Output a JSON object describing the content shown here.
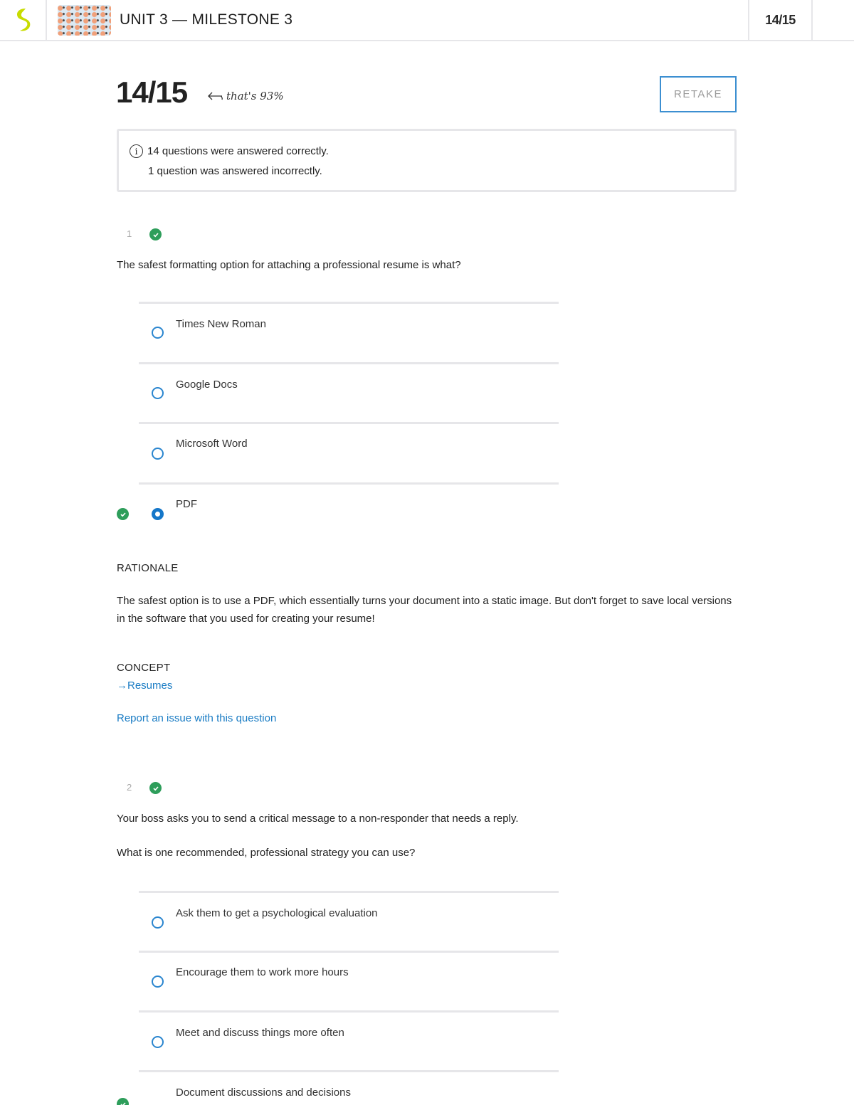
{
  "header": {
    "logo_icon": "sophia-logo-icon",
    "course_thumbnail": "course-thumbnail",
    "title": "UNIT 3 — MILESTONE 3",
    "score": "14/15"
  },
  "results": {
    "score": "14/15",
    "percent_note": "that's 93%",
    "percent_value": 93,
    "retake_label": "RETAKE",
    "summary_correct": "14 questions were answered correctly.",
    "summary_incorrect": "1 question was answered incorrectly."
  },
  "questions": [
    {
      "number": "1",
      "status": "correct",
      "text": "The safest formatting option for attaching a professional resume is what?",
      "options": [
        {
          "label": "Times New Roman",
          "selected": false,
          "correct": false
        },
        {
          "label": "Google Docs",
          "selected": false,
          "correct": false
        },
        {
          "label": "Microsoft Word",
          "selected": false,
          "correct": false
        },
        {
          "label": "PDF",
          "selected": true,
          "correct": true
        }
      ],
      "rationale_heading": "RATIONALE",
      "rationale": "The safest option is to use a PDF, which essentially turns your document into a static image. But don't forget to save local versions in the software that you used for creating your resume!",
      "concept_heading": "CONCEPT",
      "concept_link": "Resumes",
      "report_link": "Report an issue with this question"
    },
    {
      "number": "2",
      "status": "correct",
      "text": "Your boss asks you to send a critical message to a non-responder that needs a reply.",
      "text2": "What is one recommended, professional strategy you can use?",
      "options": [
        {
          "label": "Ask them to get a psychological evaluation",
          "selected": false,
          "correct": false
        },
        {
          "label": "Encourage them to work more hours",
          "selected": false,
          "correct": false
        },
        {
          "label": "Meet and discuss things more often",
          "selected": false,
          "correct": false
        },
        {
          "label": "Document discussions and decisions",
          "selected": true,
          "correct": true
        }
      ]
    }
  ],
  "colors": {
    "accent_blue": "#1577c9",
    "link_blue": "#1a7cc4",
    "correct_green": "#2e9e5b",
    "logo_lime": "#c8dc00",
    "border_gray": "#e6e6e9"
  }
}
